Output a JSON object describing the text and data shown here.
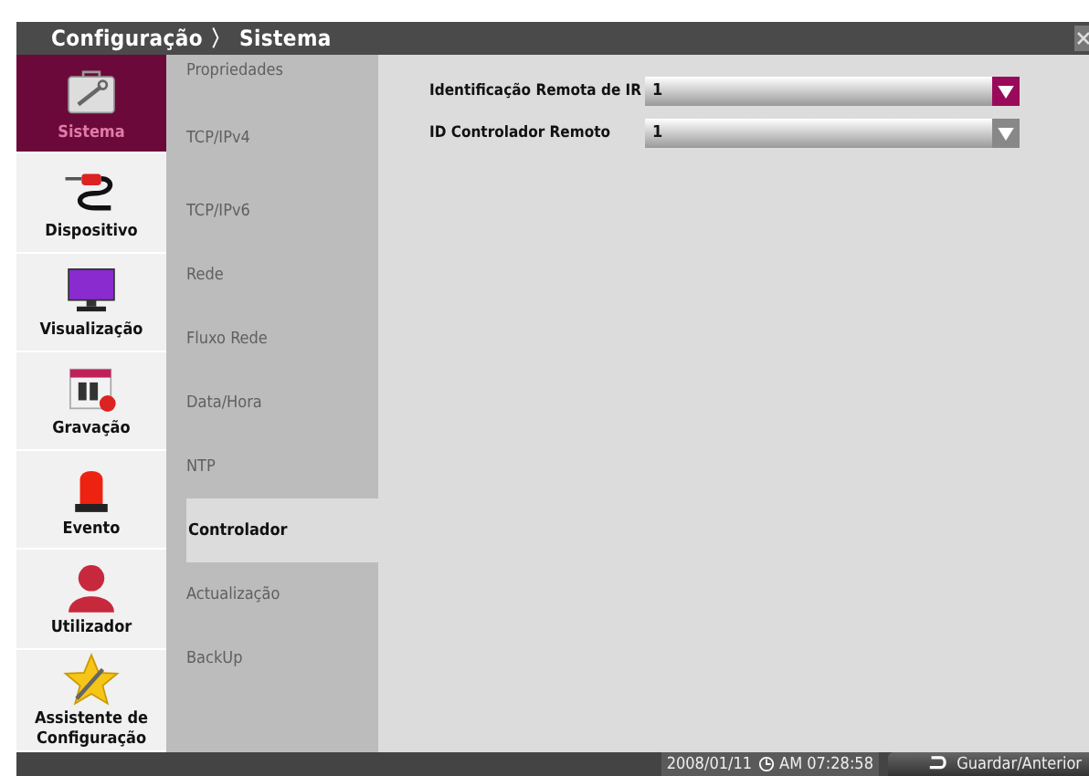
{
  "title_bar": {
    "breadcrumb": [
      "Configuração",
      "Sistema"
    ],
    "separator": "〉"
  },
  "sidebar": {
    "items": [
      {
        "label": "Sistema",
        "selected": true
      },
      {
        "label": "Dispositivo",
        "selected": false
      },
      {
        "label": "Visualização",
        "selected": false
      },
      {
        "label": "Gravação",
        "selected": false
      },
      {
        "label": "Evento",
        "selected": false
      },
      {
        "label": "Utilizador",
        "selected": false
      },
      {
        "label": "Assistente de Configuração",
        "selected": false
      }
    ]
  },
  "submenu": {
    "items": [
      {
        "label": "Propriedades",
        "selected": false
      },
      {
        "label": "TCP/IPv4",
        "selected": false
      },
      {
        "label": "TCP/IPv6",
        "selected": false
      },
      {
        "label": "Rede",
        "selected": false
      },
      {
        "label": "Fluxo Rede",
        "selected": false
      },
      {
        "label": "Data/Hora",
        "selected": false
      },
      {
        "label": "NTP",
        "selected": false
      },
      {
        "label": "Controlador",
        "selected": true
      },
      {
        "label": "Actualização",
        "selected": false
      },
      {
        "label": "BackUp",
        "selected": false
      }
    ]
  },
  "settings": [
    {
      "label": "Identificação Remota de IR",
      "value": "1",
      "focused": true
    },
    {
      "label": "ID Controlador Remoto",
      "value": "1",
      "focused": false
    }
  ],
  "status_bar": {
    "date": "2008/01/11",
    "time": "AM 07:28:58",
    "button": "Guardar/Anterior"
  }
}
